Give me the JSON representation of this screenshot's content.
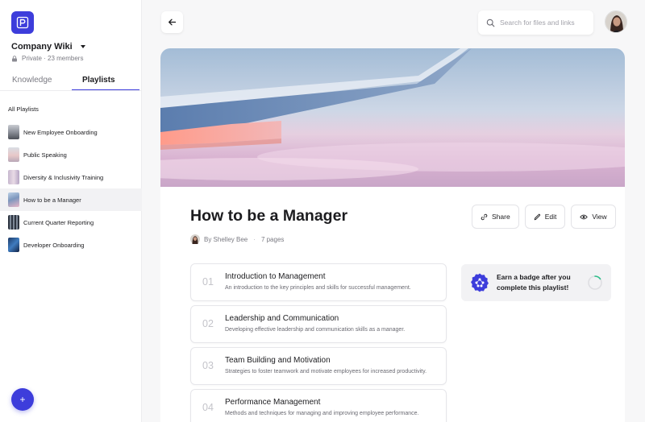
{
  "workspace": {
    "name": "Company Wiki",
    "meta": "Private · 23 members"
  },
  "tabs": {
    "knowledge": "Knowledge",
    "playlists": "Playlists"
  },
  "sidebar": {
    "all_label": "All Playlists",
    "items": [
      {
        "label": "New Employee Onboarding",
        "thumb": "city"
      },
      {
        "label": "Public Speaking",
        "thumb": "sky"
      },
      {
        "label": "Diversity & Inclusivity Training",
        "thumb": "lavender"
      },
      {
        "label": "How to be a Manager",
        "thumb": "wing",
        "active": true
      },
      {
        "label": "Current Quarter Reporting",
        "thumb": "building"
      },
      {
        "label": "Developer Onboarding",
        "thumb": "tech"
      }
    ]
  },
  "search": {
    "placeholder": "Search for files and links"
  },
  "playlist": {
    "title": "How to be a Manager",
    "author": "By Shelley Bee",
    "separator": "·",
    "pages": "7 pages"
  },
  "actions": {
    "share": "Share",
    "edit": "Edit",
    "view": "View"
  },
  "lessons": [
    {
      "num": "01",
      "title": "Introduction to Management",
      "desc": "An introduction to the key principles and skills for successful management."
    },
    {
      "num": "02",
      "title": "Leadership and Communication",
      "desc": "Developing effective leadership and communication skills as a manager."
    },
    {
      "num": "03",
      "title": "Team Building and Motivation",
      "desc": "Strategies to foster teamwork and motivate employees for increased productivity."
    },
    {
      "num": "04",
      "title": "Performance Management",
      "desc": "Methods and techniques for managing and improving employee performance."
    }
  ],
  "badge": {
    "line1": "Earn a badge after you",
    "line2": "complete this playlist!",
    "progress": 0.15
  },
  "colors": {
    "accent": "#3d3ddb",
    "progress": "#2fbf8a"
  },
  "fab": {
    "label": "+"
  }
}
